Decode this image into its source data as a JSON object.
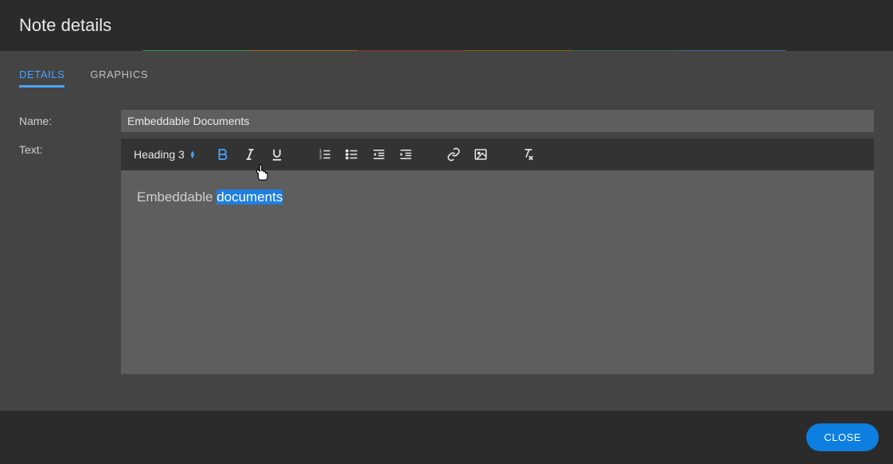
{
  "dialog": {
    "title": "Note details"
  },
  "tabs": {
    "details": "Details",
    "graphics": "Graphics"
  },
  "form": {
    "name_label": "Name:",
    "text_label": "Text:",
    "name_value": "Embeddable Documents"
  },
  "toolbar": {
    "heading_label": "Heading 3"
  },
  "editor": {
    "prefix": "Embeddable ",
    "selected": "documents"
  },
  "footer": {
    "close": "Close"
  }
}
